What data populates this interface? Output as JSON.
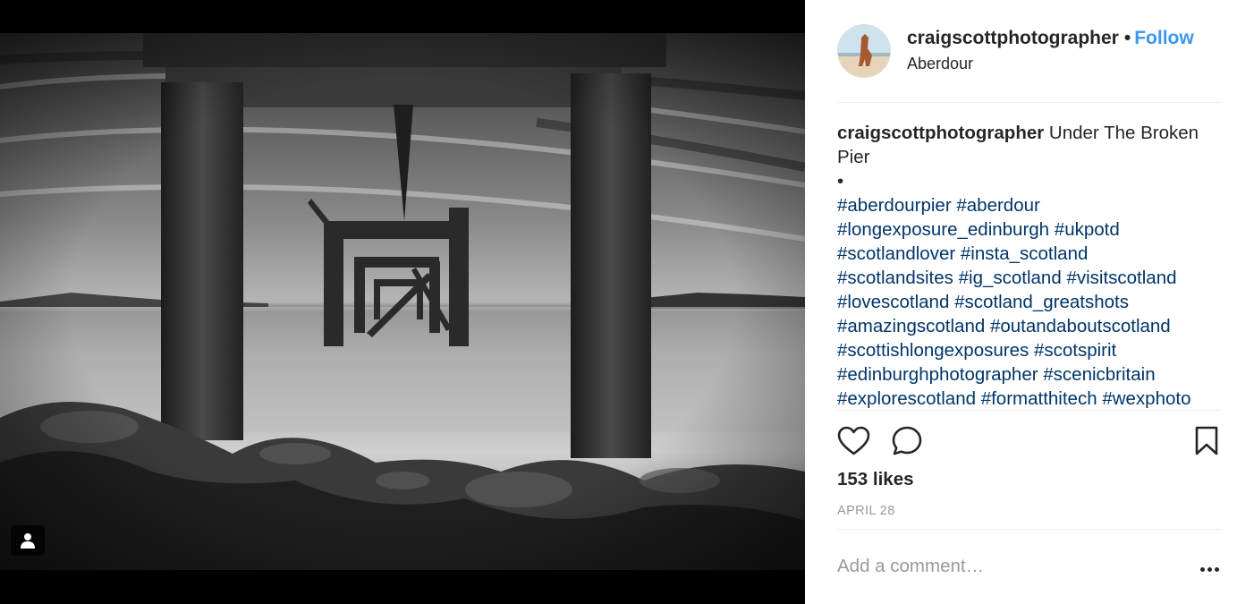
{
  "post": {
    "username": "craigscottphotographer",
    "follow_label": "Follow",
    "separator": "•",
    "location": "Aberdour",
    "caption_title": "Under The Broken Pier",
    "caption_bullet": "•",
    "hashtags": [
      "#aberdourpier",
      "#aberdour",
      "#longexposure_edinburgh",
      "#ukpotd",
      "#scotlandlover",
      "#insta_scotland",
      "#scotlandsites",
      "#ig_scotland",
      "#visitscotland",
      "#lovescotland",
      "#scotland_greatshots",
      "#amazingscotland",
      "#outandaboutscotland",
      "#scottishlongexposures",
      "#scotspirit",
      "#edinburghphotographer",
      "#scenicbritain",
      "#explorescotland",
      "#formatthitech",
      "#wexphoto"
    ],
    "likes": "153 likes",
    "date": "APRIL 28",
    "comment_placeholder": "Add a comment…"
  },
  "icons": {
    "like": "heart-outline-icon",
    "comment": "speech-bubble-icon",
    "save": "bookmark-icon",
    "more": "ellipsis-icon",
    "tagged": "user-tag-icon"
  },
  "colors": {
    "follow": "#3897f0",
    "hashtag": "#003569",
    "text": "#262626",
    "muted": "#999999",
    "divider": "#efefef"
  }
}
